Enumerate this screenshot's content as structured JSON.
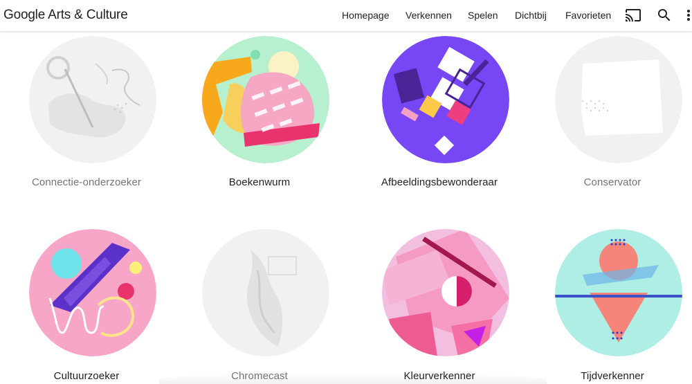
{
  "header": {
    "logo": "Google Arts & Culture",
    "nav": [
      "Homepage",
      "Verkennen",
      "Spelen",
      "Dichtbij",
      "Favorieten"
    ]
  },
  "icons": {
    "cast": "cast-icon",
    "search": "search-icon",
    "more": "more-vert-icon"
  },
  "colors": {
    "text": "#202124",
    "muted": "#757575"
  },
  "cards": [
    {
      "label": "Connectie-onderzoeker",
      "state": "locked"
    },
    {
      "label": "Boekenwurm",
      "state": "unlocked"
    },
    {
      "label": "Afbeeldingsbewonderaar",
      "state": "unlocked"
    },
    {
      "label": "Conservator",
      "state": "locked"
    },
    {
      "label": "Cultuurzoeker",
      "state": "unlocked"
    },
    {
      "label": "Chromecast",
      "state": "locked"
    },
    {
      "label": "Kleurverkenner",
      "state": "unlocked"
    },
    {
      "label": "Tijdverkenner",
      "state": "unlocked"
    }
  ]
}
